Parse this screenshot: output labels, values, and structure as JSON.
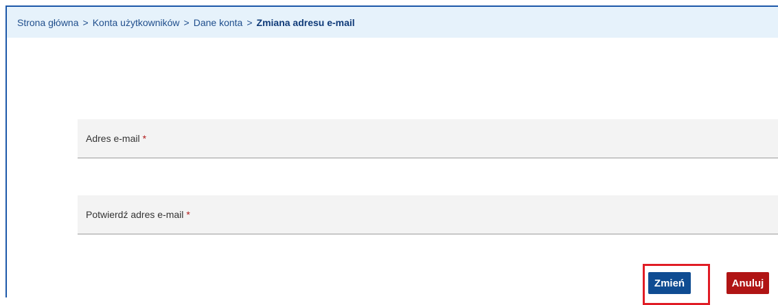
{
  "breadcrumb": {
    "items": [
      "Strona główna",
      "Konta użytkowników",
      "Dane konta"
    ],
    "separator": ">",
    "current": "Zmiana adresu e-mail"
  },
  "form": {
    "email_label": "Adres e-mail",
    "confirm_label": "Potwierdź adres e-mail",
    "required_mark": "*"
  },
  "actions": {
    "change_label": "Zmień",
    "cancel_label": "Anuluj"
  },
  "colors": {
    "breadcrumb_bg": "#e6f2fb",
    "primary": "#0f4c92",
    "danger": "#b01414",
    "highlight": "#e01b24"
  }
}
